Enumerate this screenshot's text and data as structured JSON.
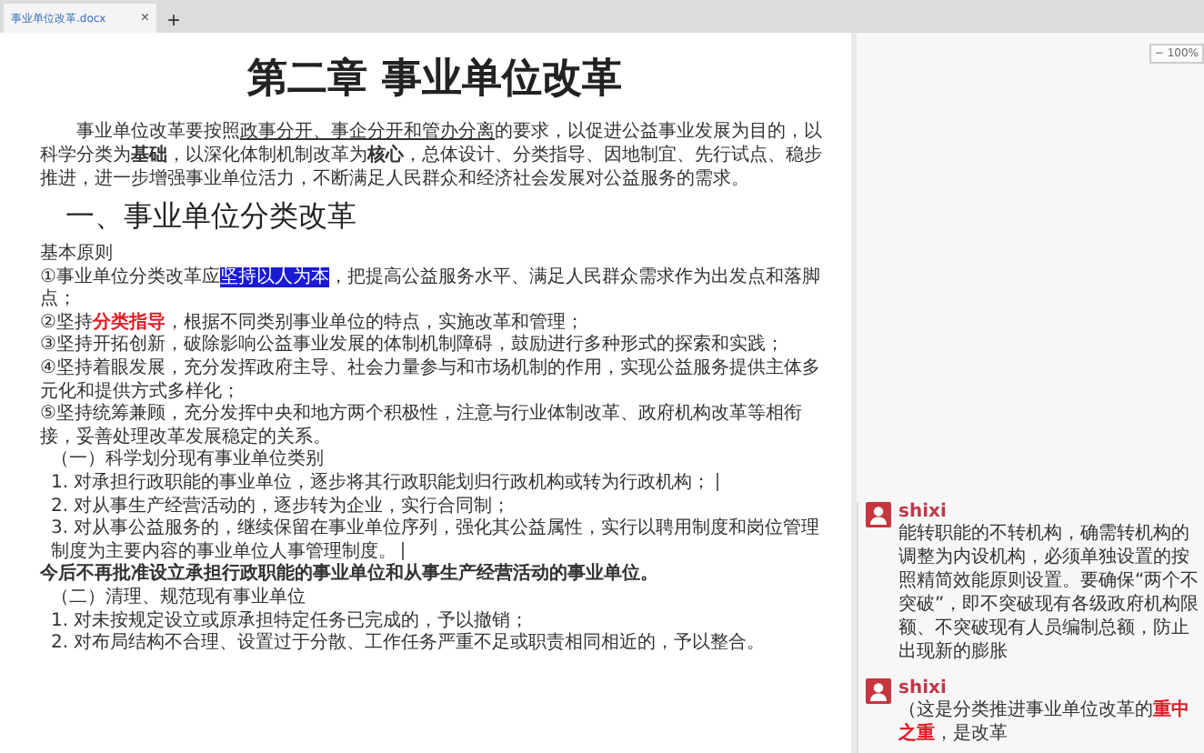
{
  "tab": {
    "title": "事业单位改革.docx",
    "close": "×",
    "new_tab": "+"
  },
  "zoom": {
    "minus": "−",
    "value": "100%"
  },
  "document": {
    "title": "第二章  事业单位改革",
    "intro": [
      {
        "text": "事业单位改革要按照",
        "kind": "plain"
      },
      {
        "text": "政事分开、事企分开和管办分离",
        "kind": "underline"
      },
      {
        "text": "的要求，以促进公益事业发展为目的，以科学分类为",
        "kind": "plain"
      },
      {
        "text": "基础",
        "kind": "bold"
      },
      {
        "text": "，以深化体制机制改革为",
        "kind": "plain"
      },
      {
        "text": "核心",
        "kind": "bold"
      },
      {
        "text": "，总体设计、分类指导、因地制宜、先行试点、稳步推进，进一步增强事业单位活力，不断满足人民群众和经济社会发展对公益服务的需求。",
        "kind": "plain"
      }
    ],
    "heading": "一、事业单位分类改革",
    "paragraphs": [
      {
        "kind": "line",
        "segments": [
          {
            "text": "基本原则",
            "kind": "plain"
          }
        ]
      },
      {
        "kind": "line",
        "segments": [
          {
            "text": "①事业单位分类改革应",
            "kind": "plain"
          },
          {
            "text": "坚持以人为本",
            "kind": "highlight"
          },
          {
            "text": "，把提高公益服务水平、满足人民群众需求作为出发点和落脚点；",
            "kind": "plain"
          }
        ]
      },
      {
        "kind": "line",
        "segments": [
          {
            "text": "②坚持",
            "kind": "plain"
          },
          {
            "text": "分类指导",
            "kind": "red"
          },
          {
            "text": "，根据不同类别事业单位的特点，实施改革和管理；",
            "kind": "plain"
          }
        ]
      },
      {
        "kind": "line",
        "segments": [
          {
            "text": "③坚持开拓创新，破除影响公益事业发展的体制机制障碍，鼓励进行多种形式的探索和实践；",
            "kind": "plain"
          }
        ]
      },
      {
        "kind": "line",
        "segments": [
          {
            "text": "④坚持着眼发展，充分发挥政府主导、社会力量参与和市场机制的作用，实现公益服务提供主体多元化和提供方式多样化；",
            "kind": "plain"
          }
        ]
      },
      {
        "kind": "line",
        "segments": [
          {
            "text": "⑤坚持统筹兼顾，充分发挥中央和地方两个积极性，注意与行业体制改革、政府机构改革等相衔接，妥善处理改革发展稳定的关系。",
            "kind": "plain"
          }
        ]
      },
      {
        "kind": "sub",
        "segments": [
          {
            "text": "（一）科学划分现有事业单位类别",
            "kind": "plain"
          }
        ]
      },
      {
        "kind": "item",
        "segments": [
          {
            "text": "1. 对承担行政职能的事业单位，逐步将其行政职能划归行政机构或转为行政机构；",
            "kind": "plain"
          }
        ],
        "comment_anchor": true
      },
      {
        "kind": "item",
        "segments": [
          {
            "text": "2. 对从事生产经营活动的，逐步转为企业，实行合同制；",
            "kind": "plain"
          }
        ]
      },
      {
        "kind": "item",
        "segments": [
          {
            "text": "3. 对从事公益服务的，继续保留在事业单位序列，强化其公益属性，实行以聘用制度和岗位管理制度为主要内容的事业单位人事管理制度。",
            "kind": "plain"
          }
        ],
        "comment_anchor": true
      },
      {
        "kind": "note",
        "segments": [
          {
            "text": "今后不再批准设立承担行政职能的事业单位和从事生产经营活动的事业单位。",
            "kind": "plain"
          }
        ]
      },
      {
        "kind": "sub",
        "segments": [
          {
            "text": "（二）清理、规范现有事业单位",
            "kind": "plain"
          }
        ]
      },
      {
        "kind": "item",
        "segments": [
          {
            "text": "1. 对未按规定设立或原承担特定任务已完成的，予以撤销；",
            "kind": "plain"
          }
        ]
      },
      {
        "kind": "item",
        "segments": [
          {
            "text": "2. 对布局结构不合理、设置过于分散、工作任务严重不足或职责相同相近的，予以整合。",
            "kind": "plain"
          }
        ]
      }
    ]
  },
  "comments": [
    {
      "author": "shixi",
      "segments": [
        {
          "text": "能转职能的不转机构，确需转机构的调整为内设机构，必须单独设置的按照精简效能原则设置。要确保“两个不突破”，即不突破现有各级政府机构限额、不突破现有人员编制总额，防止出现新的膨胀",
          "kind": "plain"
        }
      ]
    },
    {
      "author": "shixi",
      "segments": [
        {
          "text": "（这是分类推进事业单位改革的",
          "kind": "plain"
        },
        {
          "text": "重中之重",
          "kind": "red"
        },
        {
          "text": "，是改革",
          "kind": "plain"
        }
      ]
    }
  ]
}
